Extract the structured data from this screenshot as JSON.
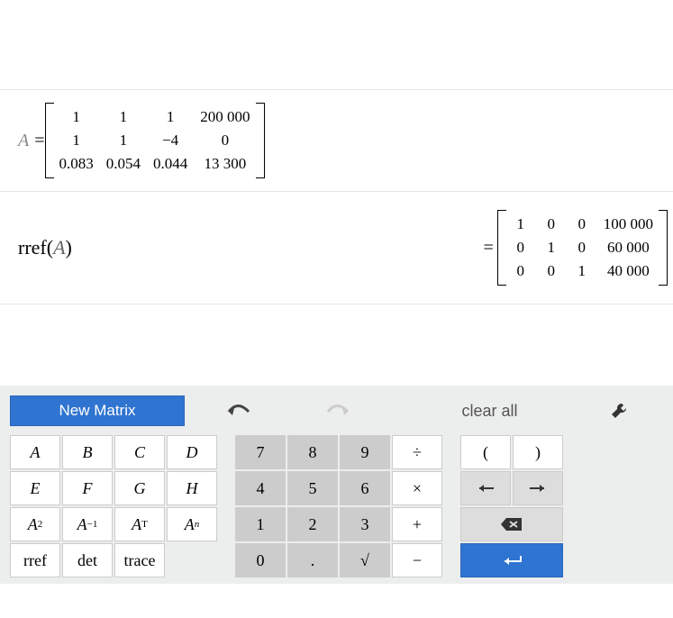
{
  "matrix_def": {
    "name": "A",
    "equals": "=",
    "cells": [
      [
        "1",
        "1",
        "1",
        "200 000"
      ],
      [
        "1",
        "1",
        "−4",
        "0"
      ],
      [
        "0.083",
        "0.054",
        "0.044",
        "13 300"
      ]
    ]
  },
  "result": {
    "lhs_func": "rref",
    "lhs_arg": "A",
    "equals": "=",
    "cells": [
      [
        "1",
        "0",
        "0",
        "100 000"
      ],
      [
        "0",
        "1",
        "0",
        "60 000"
      ],
      [
        "0",
        "0",
        "1",
        "40 000"
      ]
    ]
  },
  "keyboard": {
    "new_matrix": "New Matrix",
    "undo": "undo",
    "redo": "redo",
    "clear_all": "clear all",
    "tools": "tools",
    "vars": {
      "row1": [
        "A",
        "B",
        "C",
        "D"
      ],
      "row2": [
        "E",
        "F",
        "G",
        "H"
      ],
      "row3_labels": [
        "A^2",
        "A^{-1}",
        "A^T",
        "A^n"
      ],
      "row4": [
        "rref",
        "det",
        "trace"
      ]
    },
    "nums": {
      "r1": [
        "7",
        "8",
        "9",
        "÷"
      ],
      "r2": [
        "4",
        "5",
        "6",
        "×"
      ],
      "r3": [
        "1",
        "2",
        "3",
        "+"
      ],
      "r4": [
        "0",
        ".",
        "√",
        "−"
      ]
    },
    "right": {
      "r1": [
        "(",
        ")"
      ],
      "r2": [
        "←",
        "→"
      ],
      "r3_label": "backspace",
      "r4_label": "enter"
    }
  }
}
